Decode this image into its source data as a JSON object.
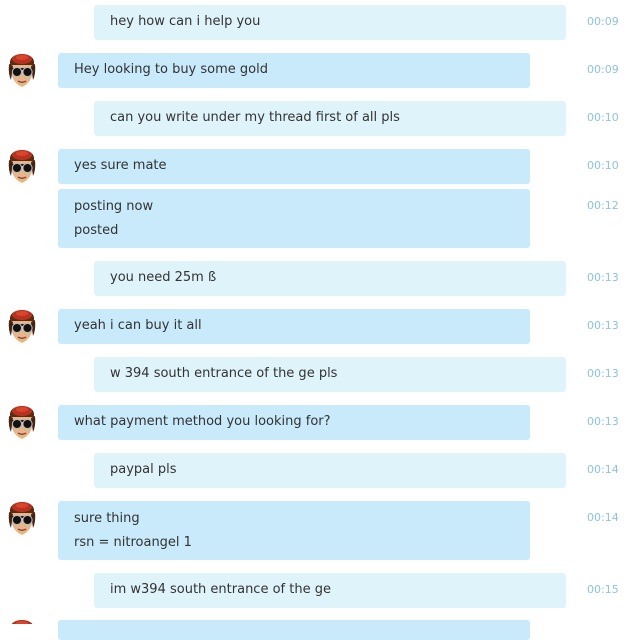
{
  "conversation": {
    "messages": [
      {
        "direction": "outgoing",
        "lines": [
          "hey how can i help you"
        ],
        "time": "00:09"
      },
      {
        "direction": "incoming",
        "avatar": true,
        "lines": [
          "Hey looking to buy some gold"
        ],
        "time": "00:09"
      },
      {
        "direction": "outgoing",
        "lines": [
          "can you write under my thread first of all pls"
        ],
        "time": "00:10"
      },
      {
        "direction": "incoming",
        "avatar": true,
        "lines": [
          "yes sure mate"
        ],
        "time": "00:10"
      },
      {
        "direction": "incoming",
        "avatar": false,
        "lines": [
          "posting now",
          "posted"
        ],
        "time": "00:12"
      },
      {
        "direction": "outgoing",
        "lines": [
          "you need 25m ß"
        ],
        "time": "00:13"
      },
      {
        "direction": "incoming",
        "avatar": true,
        "lines": [
          "yeah i can buy it all"
        ],
        "time": "00:13"
      },
      {
        "direction": "outgoing",
        "lines": [
          "w 394 south entrance of the ge pls"
        ],
        "time": "00:13"
      },
      {
        "direction": "incoming",
        "avatar": true,
        "lines": [
          "what payment method you looking for?"
        ],
        "time": "00:13"
      },
      {
        "direction": "outgoing",
        "lines": [
          "paypal pls"
        ],
        "time": "00:14"
      },
      {
        "direction": "incoming",
        "avatar": true,
        "lines": [
          "sure thing",
          "rsn = nitroangel 1"
        ],
        "time": "00:14"
      },
      {
        "direction": "outgoing",
        "lines": [
          "im w394 south entrance of the ge"
        ],
        "time": "00:15"
      }
    ]
  },
  "colors": {
    "outgoing_bubble": "#dff3fb",
    "incoming_bubble": "#c8eafb",
    "timestamp": "#8fc2e0",
    "text": "#333333"
  },
  "icons": {
    "contact_avatar": "avatar-icon"
  }
}
